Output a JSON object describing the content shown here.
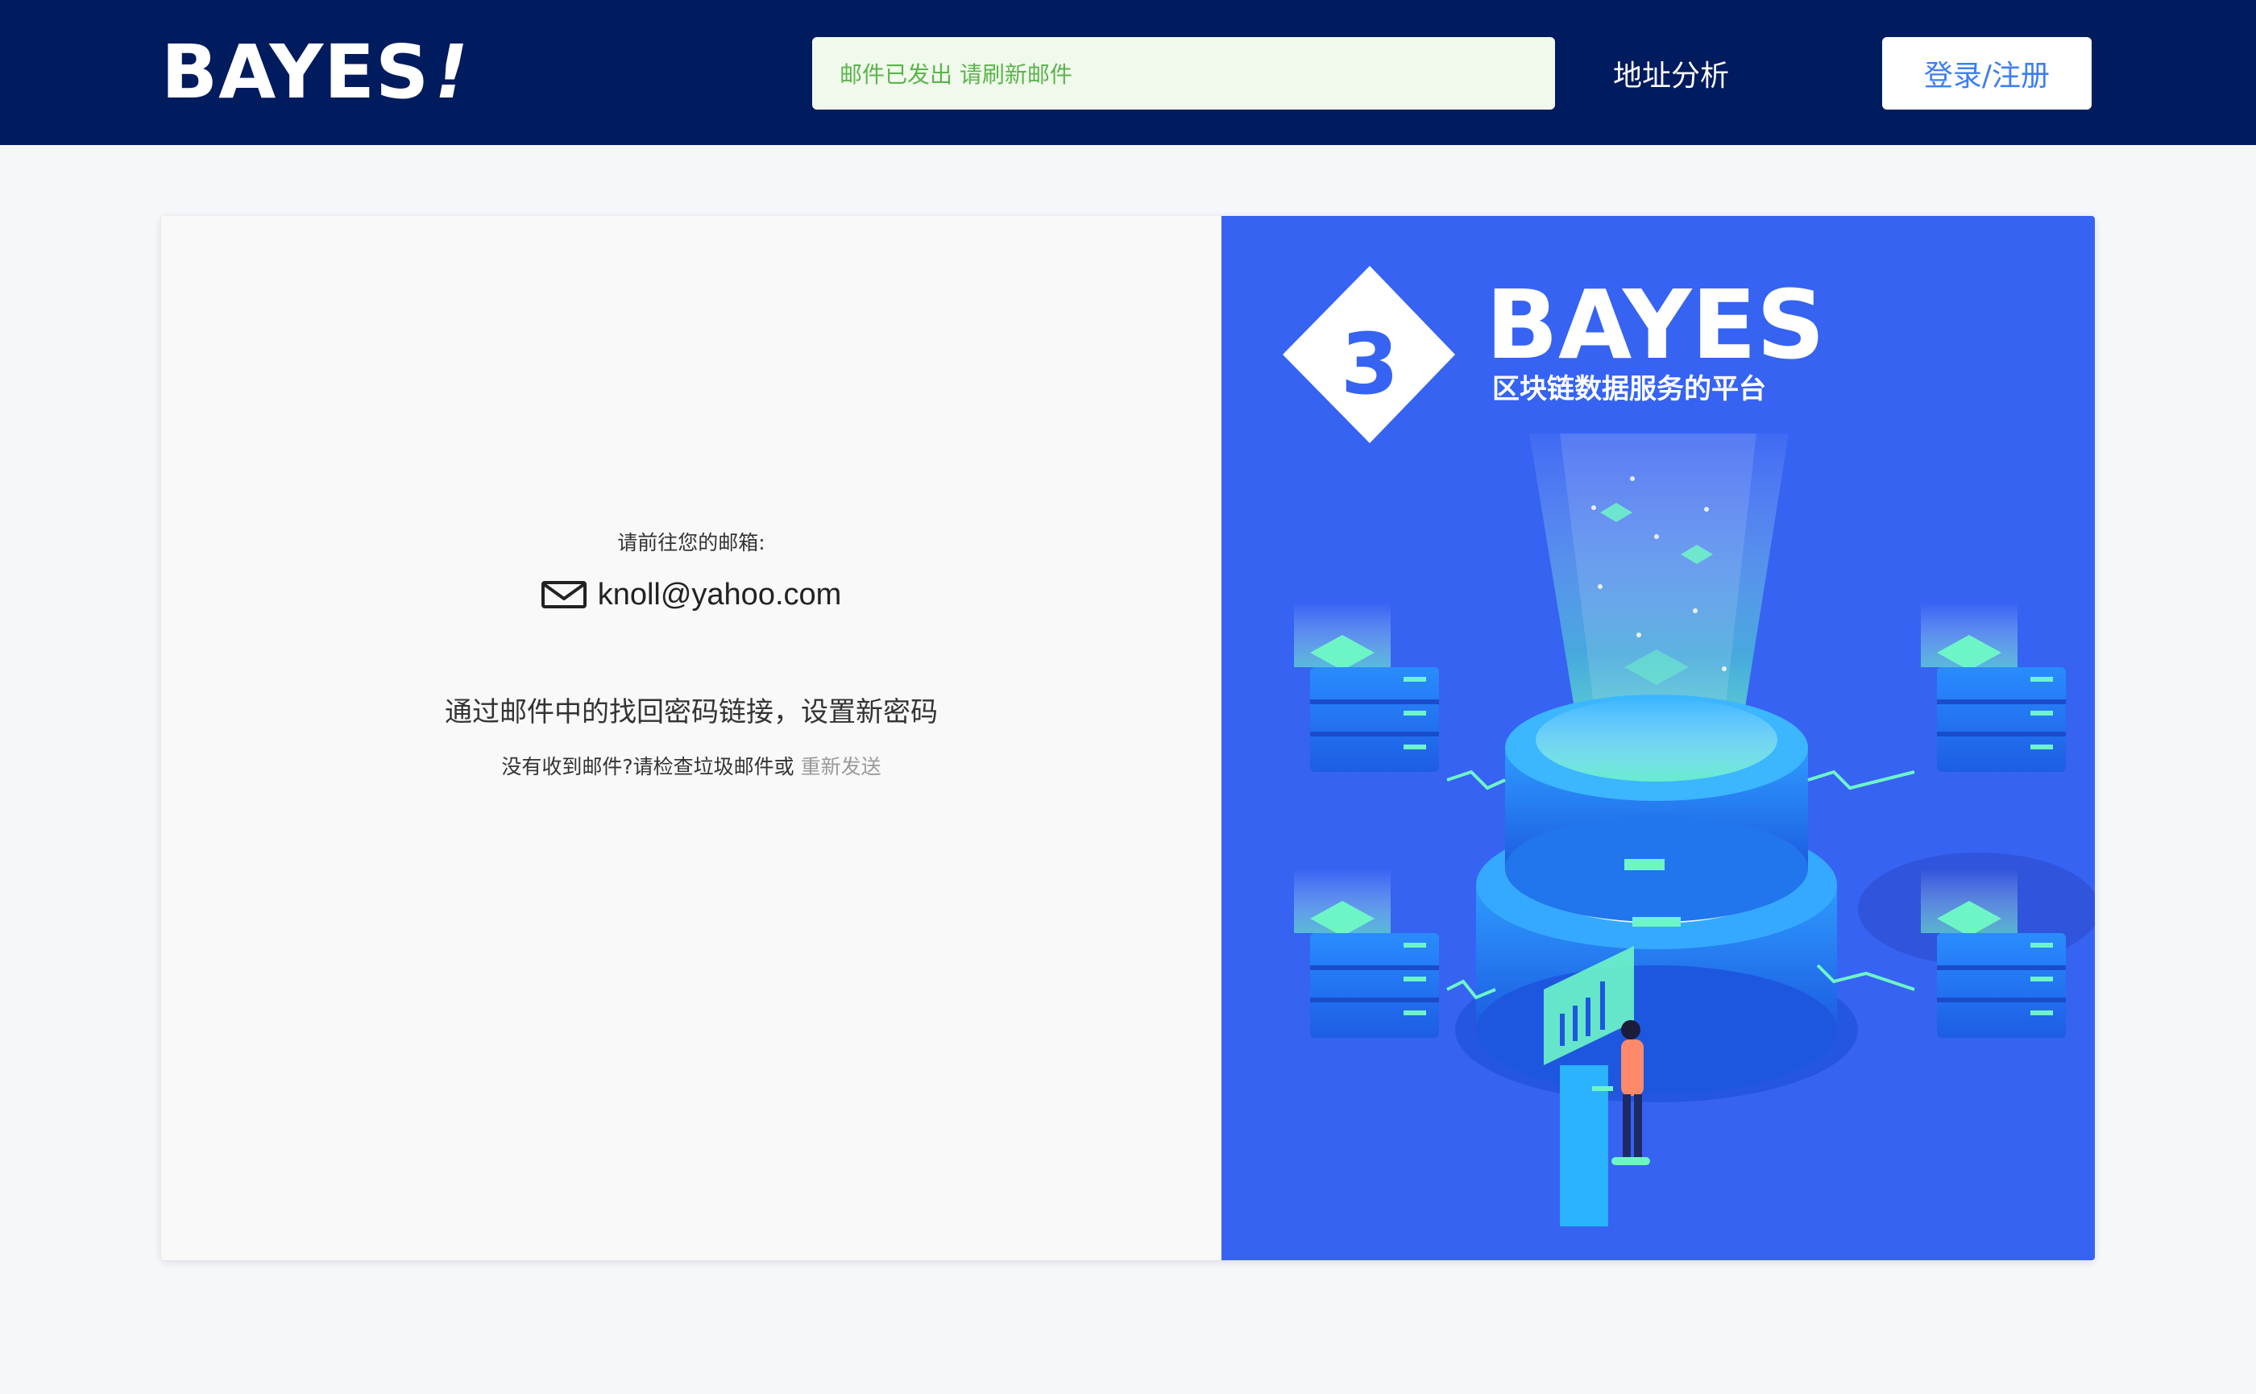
{
  "header": {
    "logo_text": "BAYES",
    "logo_bang": "!",
    "notice": "邮件已发出 请刷新邮件",
    "nav_link": "地址分析",
    "login_button": "登录/注册"
  },
  "main": {
    "goto_label": "请前往您的邮箱:",
    "email": "knoll@yahoo.com",
    "instruction": "通过邮件中的找回密码链接，设置新密码",
    "not_received": "没有收到邮件?请检查垃圾邮件或",
    "resend": "重新发送"
  },
  "promo": {
    "brand": "BAYES",
    "tagline": "区块链数据服务的平台",
    "logo_letter": "3"
  },
  "colors": {
    "header_bg": "#011b5f",
    "notice_bg": "#f0f9eb",
    "notice_text": "#5bb44d",
    "accent": "#3e7ef2",
    "promo_bg": "#3663f2"
  }
}
